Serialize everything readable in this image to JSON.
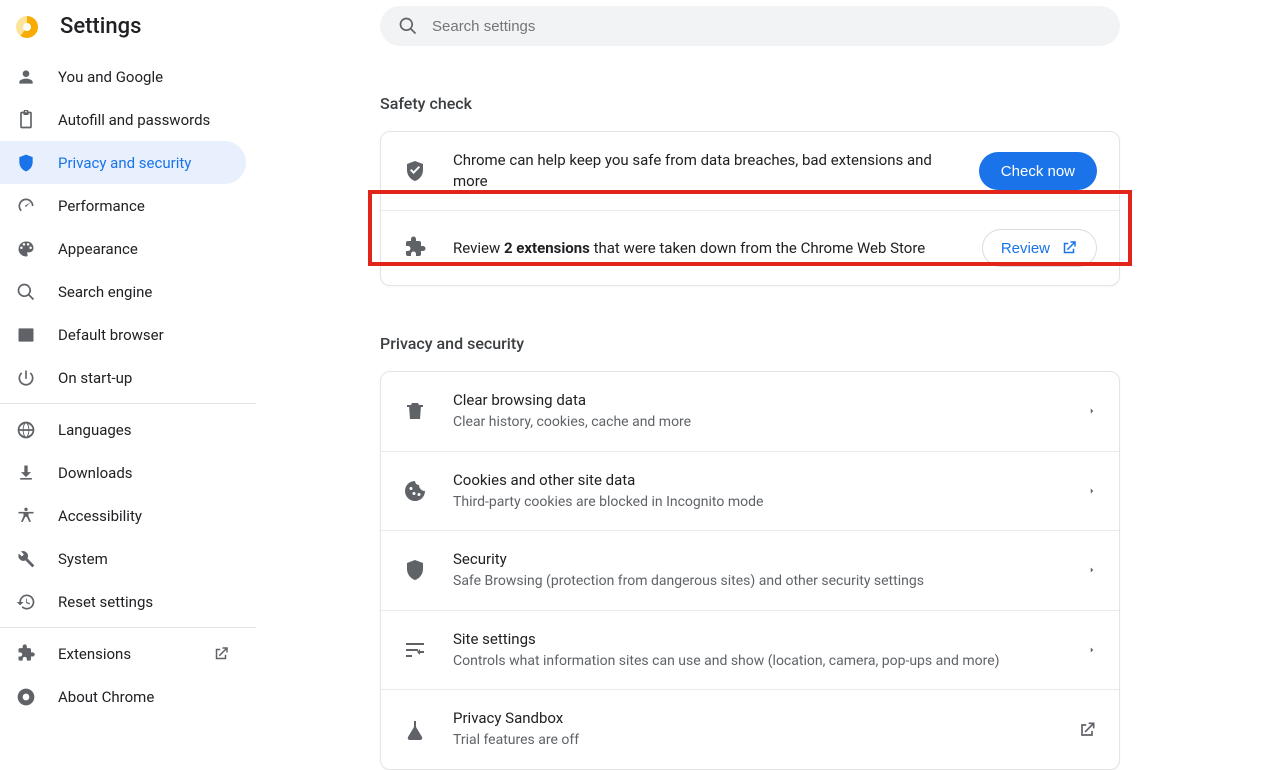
{
  "header": {
    "title": "Settings"
  },
  "search": {
    "placeholder": "Search settings"
  },
  "sidebar": {
    "group1": [
      {
        "label": "You and Google"
      },
      {
        "label": "Autofill and passwords"
      },
      {
        "label": "Privacy and security"
      },
      {
        "label": "Performance"
      },
      {
        "label": "Appearance"
      },
      {
        "label": "Search engine"
      },
      {
        "label": "Default browser"
      },
      {
        "label": "On start-up"
      }
    ],
    "group2": [
      {
        "label": "Languages"
      },
      {
        "label": "Downloads"
      },
      {
        "label": "Accessibility"
      },
      {
        "label": "System"
      },
      {
        "label": "Reset settings"
      }
    ],
    "group3": [
      {
        "label": "Extensions"
      },
      {
        "label": "About Chrome"
      }
    ]
  },
  "safety": {
    "section_title": "Safety check",
    "row1_text": "Chrome can help keep you safe from data breaches, bad extensions and more",
    "check_now_btn": "Check now",
    "row2_prefix": "Review ",
    "row2_bold": "2 extensions",
    "row2_suffix": " that were taken down from the Chrome Web Store",
    "review_btn": "Review"
  },
  "privacy": {
    "section_title": "Privacy and security",
    "rows": [
      {
        "title": "Clear browsing data",
        "sub": "Clear history, cookies, cache and more"
      },
      {
        "title": "Cookies and other site data",
        "sub": "Third-party cookies are blocked in Incognito mode"
      },
      {
        "title": "Security",
        "sub": "Safe Browsing (protection from dangerous sites) and other security settings"
      },
      {
        "title": "Site settings",
        "sub": "Controls what information sites can use and show (location, camera, pop-ups and more)"
      },
      {
        "title": "Privacy Sandbox",
        "sub": "Trial features are off"
      }
    ]
  }
}
